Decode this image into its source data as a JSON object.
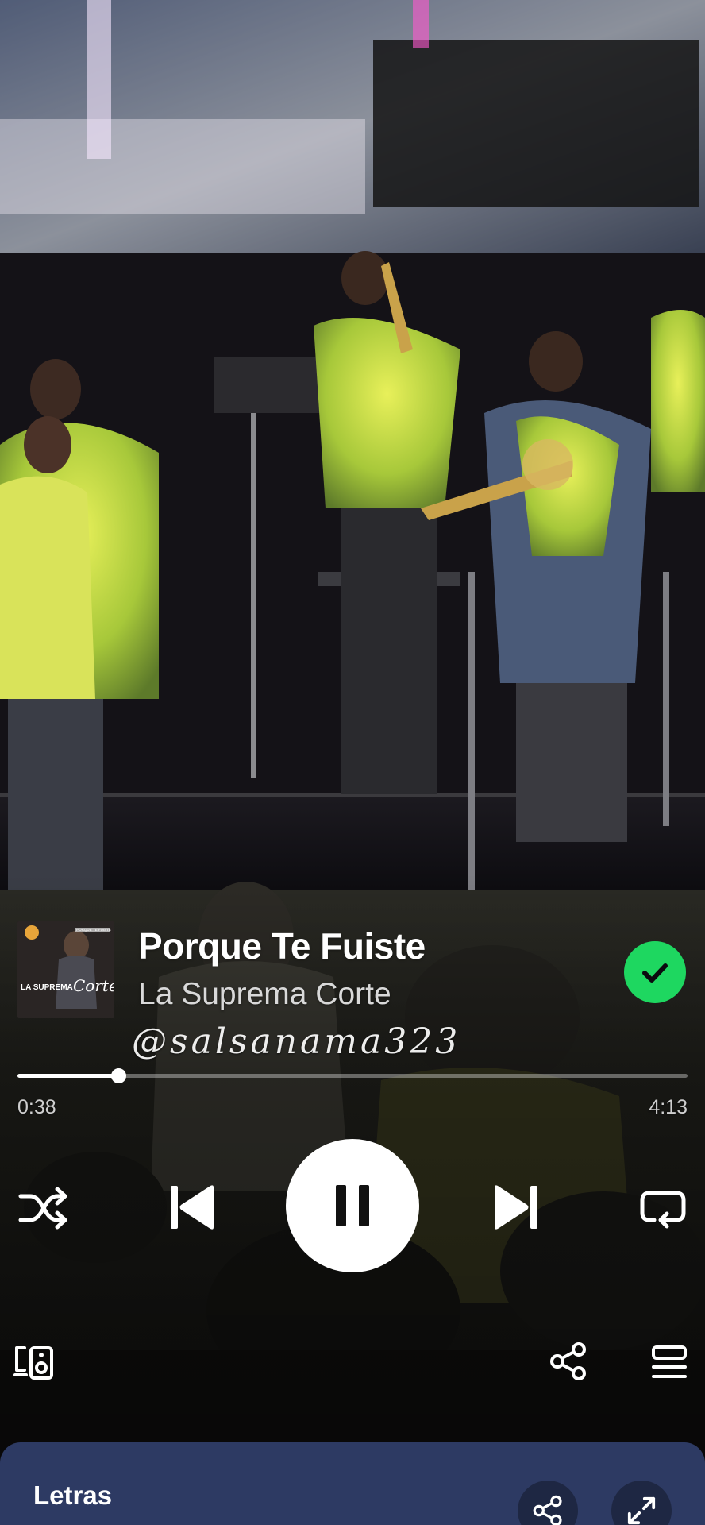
{
  "track": {
    "title": "Porque Te Fuiste",
    "artist": "La Suprema Corte",
    "album_art": {
      "text": "LA SUPREMA",
      "script_text": "Corte",
      "small_text": "PORQUE TE FUISTE"
    },
    "saved": true,
    "saved_icon": "check-icon"
  },
  "overlay": {
    "watermark": "@salsanama323"
  },
  "playback": {
    "elapsed": "0:38",
    "total": "4:13",
    "progress": 0.15,
    "state": "playing"
  },
  "controls": {
    "shuffle_icon": "shuffle-icon",
    "prev_icon": "skip-previous-icon",
    "play_pause_icon": "pause-icon",
    "next_icon": "skip-next-icon",
    "repeat_icon": "repeat-icon",
    "devices_icon": "devices-icon",
    "share_icon": "share-icon",
    "queue_icon": "queue-icon"
  },
  "lyrics": {
    "title": "Letras",
    "share_icon": "share-icon",
    "expand_icon": "expand-icon"
  },
  "colors": {
    "accent": "#1ed760",
    "lyrics_card": "#2d3a63",
    "text_primary": "#ffffff",
    "text_secondary": "#d9d9d9"
  }
}
